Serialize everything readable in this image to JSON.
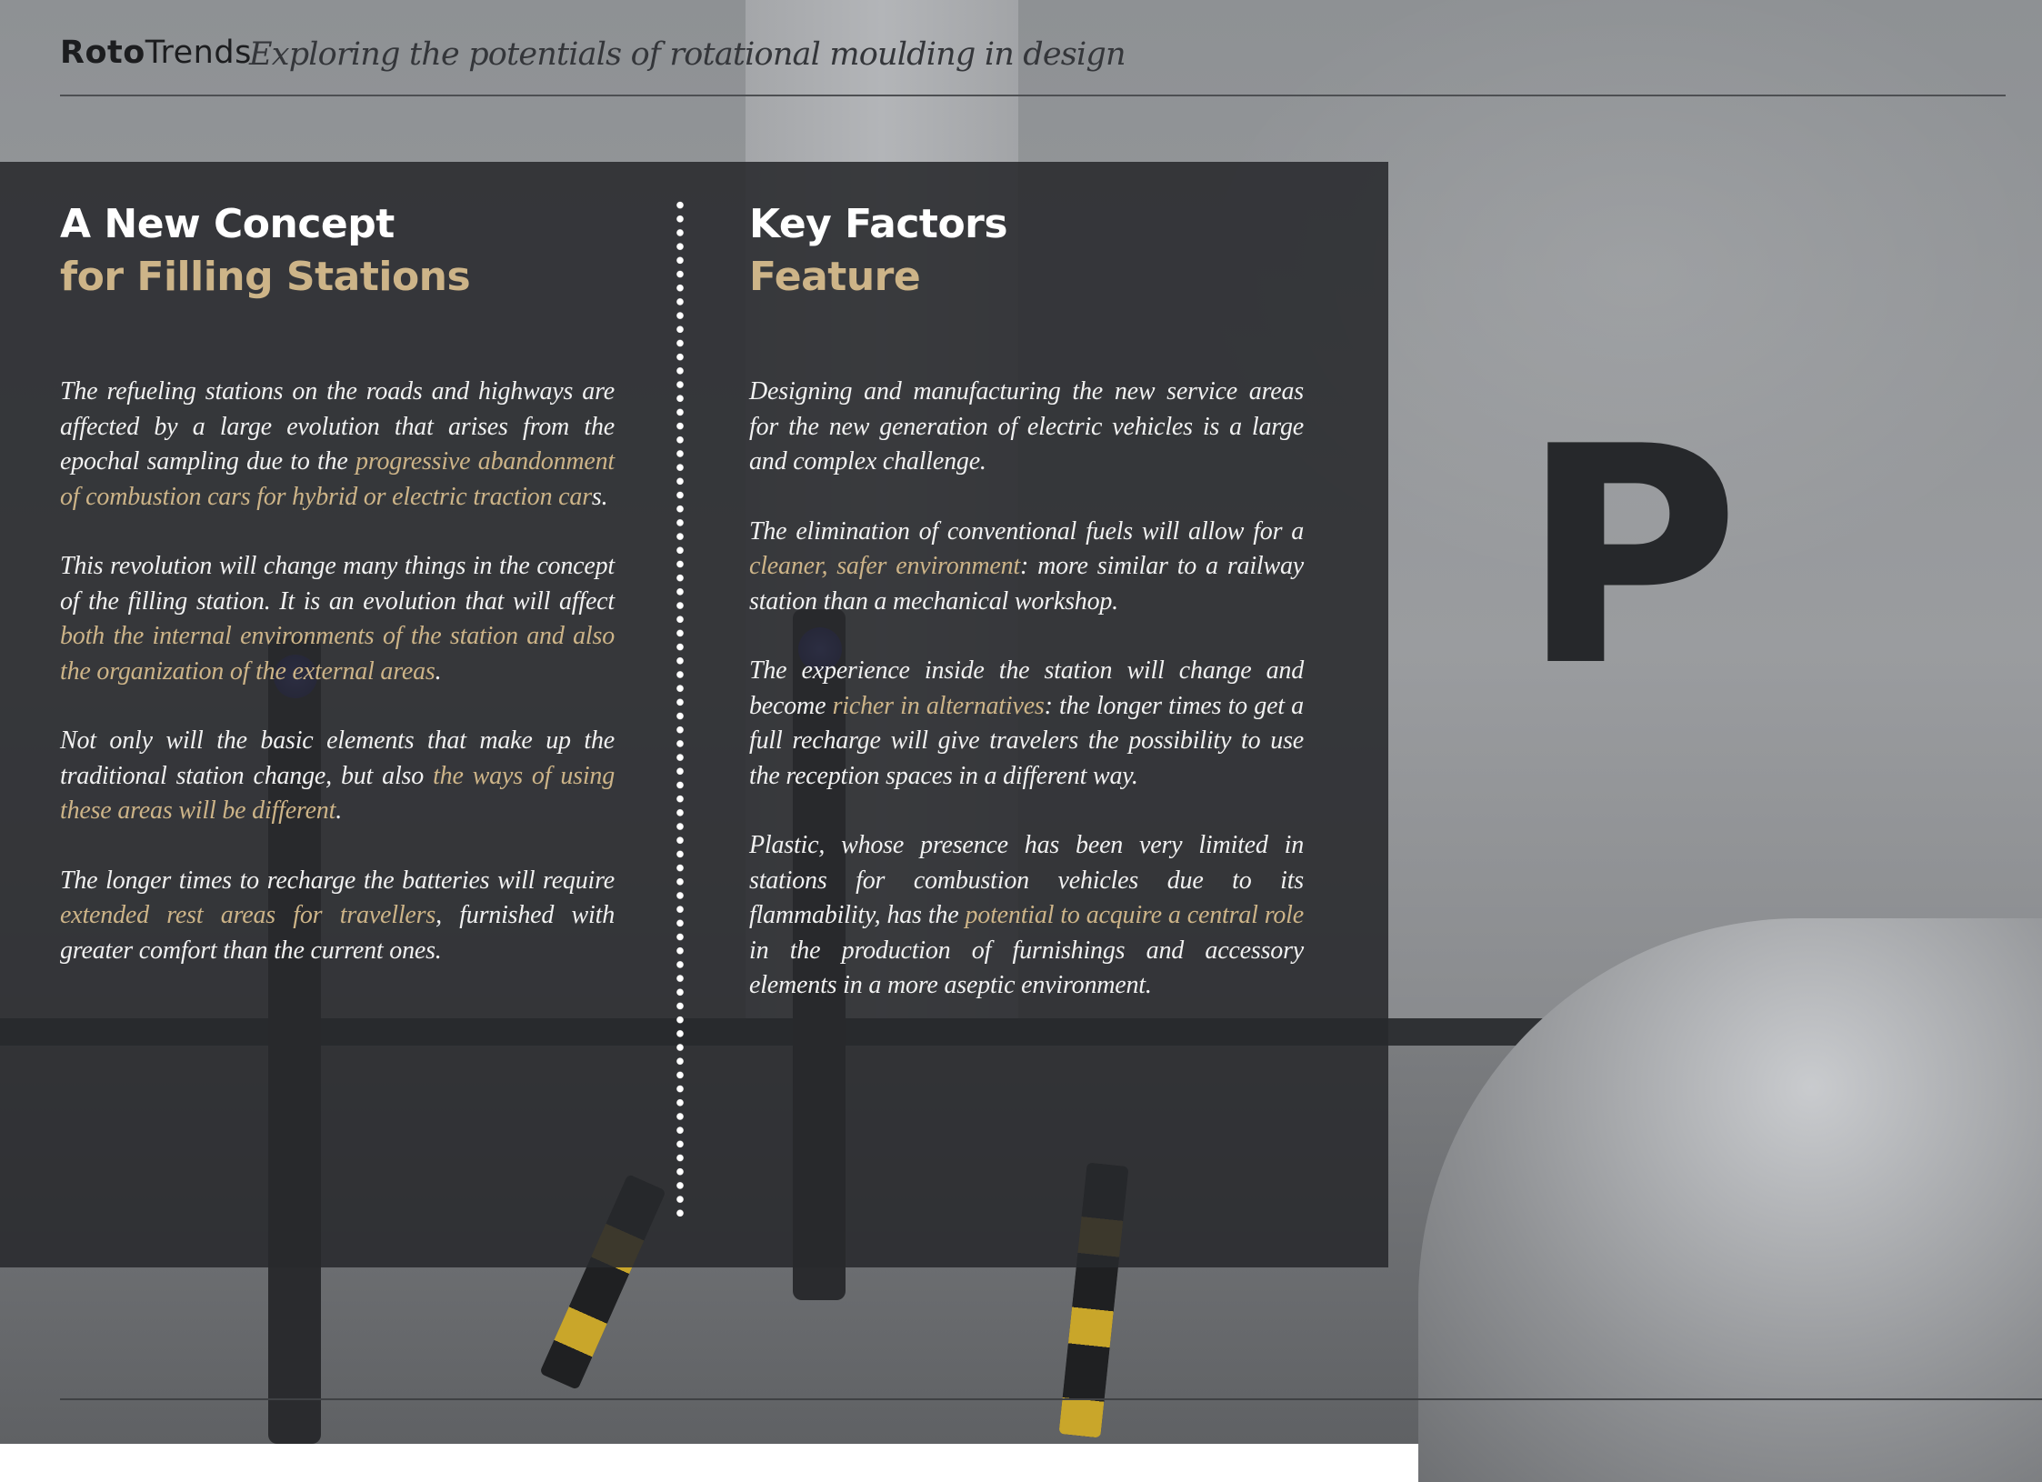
{
  "header": {
    "brand_bold": "Roto",
    "brand_regular": "Trends",
    "tagline": "Exploring the potentials of rotational moulding in design"
  },
  "background": {
    "parking_sign": "P"
  },
  "left_column": {
    "title_line1": "A New Concept",
    "title_line2": "for Filling Stations",
    "paragraphs": [
      {
        "t1": "The refueling stations on the roads and highways are affected by a large evolution that arises from the epochal sampling due to the ",
        "h1": "progressive abandonment of combustion cars for hybrid or electric traction car",
        "t2": "s."
      },
      {
        "t1": "This revolution will change many things in the concept of the filling station. It is an evolution that will affect ",
        "h1": "both the internal environments of the station and also the organization of the external areas",
        "t2": "."
      },
      {
        "t1": "Not only will the basic elements that make up the traditional station change, but also ",
        "h1": "the ways of using these areas will be different",
        "t2": "."
      },
      {
        "t1": "The longer times to recharge the batteries will require ",
        "h1": "extended rest areas for travellers",
        "t2": ", furnished with greater comfort than the current ones."
      }
    ]
  },
  "right_column": {
    "title_line1": "Key Factors",
    "title_line2": "Feature",
    "paragraphs": [
      {
        "t1": "Designing and manufacturing the new service areas for the new generation of electric vehicles is a large and complex challenge.",
        "h1": "",
        "t2": ""
      },
      {
        "t1": "The elimination of conventional fuels will allow for a ",
        "h1": "cleaner, safer environment",
        "t2": ": more similar to a railway station than a mechanical workshop."
      },
      {
        "t1": "The experience inside the station will change and become ",
        "h1": "richer in alternatives",
        "t2": ": the longer times to get a full recharge will give travelers the possibility to use the reception spaces in a different way."
      },
      {
        "t1": "Plastic, whose presence has been very limited in stations for combustion vehicles due to its flammability, has the ",
        "h1": "potential to acquire a central role",
        "t2": " in the production of furnishings and accessory elements in a more aseptic environment."
      }
    ]
  },
  "colors": {
    "accent_gold": "#cdb488",
    "panel": "#28292c",
    "text": "#f1f1f1"
  }
}
